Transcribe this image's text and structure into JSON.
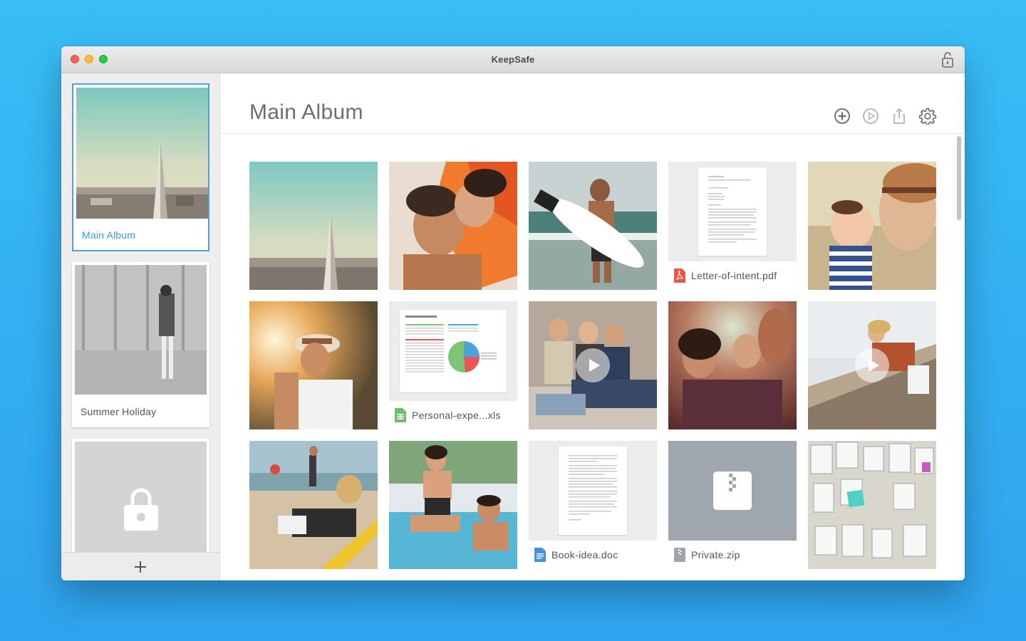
{
  "window": {
    "title": "KeepSafe"
  },
  "sidebar": {
    "albums": [
      {
        "label": "Main Album",
        "selected": true
      },
      {
        "label": "Summer Holiday",
        "selected": false
      },
      {
        "label": "",
        "locked": true
      }
    ],
    "add_icon": "plus-icon"
  },
  "main": {
    "title": "Main Album",
    "toolbar": [
      "add-icon",
      "play-icon",
      "share-icon",
      "settings-icon"
    ],
    "items": [
      {
        "type": "photo",
        "subject": "city-tower"
      },
      {
        "type": "photo",
        "subject": "couple-towel"
      },
      {
        "type": "photo",
        "subject": "surfer"
      },
      {
        "type": "file",
        "name": "Letter-of-intent.pdf",
        "icon": "pdf-icon"
      },
      {
        "type": "photo",
        "subject": "mother-baby"
      },
      {
        "type": "photo",
        "subject": "woman-hat"
      },
      {
        "type": "file",
        "name": "Personal-expe...xls",
        "icon": "spreadsheet-icon"
      },
      {
        "type": "video",
        "subject": "friends-sitting"
      },
      {
        "type": "photo",
        "subject": "party"
      },
      {
        "type": "video",
        "subject": "woman-bridge"
      },
      {
        "type": "photo",
        "subject": "beach-reading"
      },
      {
        "type": "photo",
        "subject": "pool-couple"
      },
      {
        "type": "file",
        "name": "Book-idea.doc",
        "icon": "doc-icon"
      },
      {
        "type": "file",
        "name": "Private.zip",
        "icon": "zip-icon"
      },
      {
        "type": "photo",
        "subject": "wall-sketches"
      }
    ]
  },
  "colors": {
    "accent": "#4aa3df",
    "background": "#34b2f3"
  }
}
